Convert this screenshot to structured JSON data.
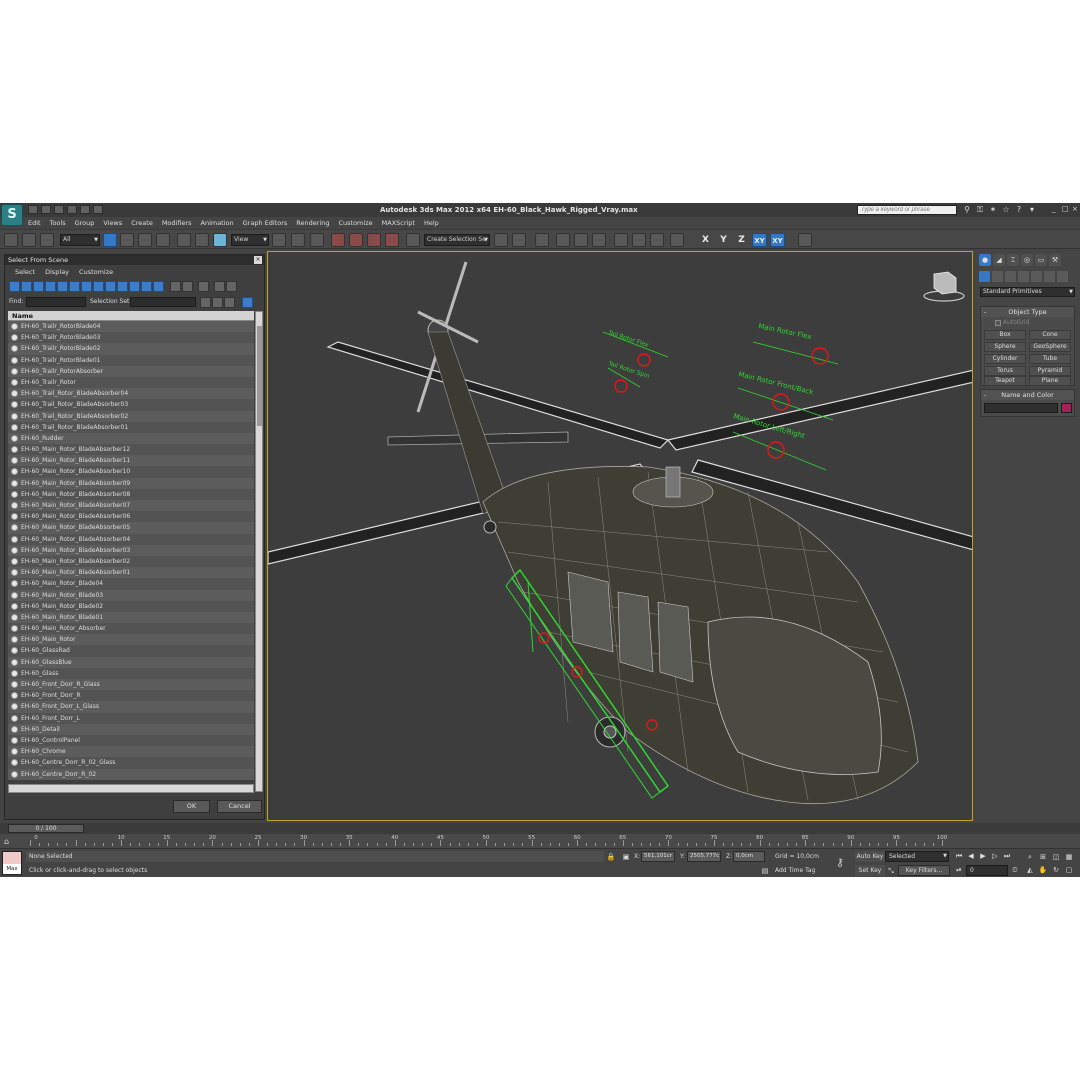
{
  "window": {
    "app_logo_glyph": "S",
    "title": "Autodesk 3ds Max  2012 x64      EH-60_Black_Hawk_Rigged_Vray.max",
    "search_placeholder": "Type a keyword or phrase",
    "controls": [
      "_",
      "□",
      "×"
    ]
  },
  "menu": [
    "Edit",
    "Tools",
    "Group",
    "Views",
    "Create",
    "Modifiers",
    "Animation",
    "Graph Editors",
    "Rendering",
    "Customize",
    "MAXScript",
    "Help"
  ],
  "toolbar": {
    "selection_filter": "All",
    "reference_coord": "View",
    "named_selection_set": "Create Selection Se",
    "axis_labels": [
      "X",
      "Y",
      "Z",
      "XY",
      "XY"
    ]
  },
  "select_dialog": {
    "title": "Select From Scene",
    "menu": [
      "Select",
      "Display",
      "Customize"
    ],
    "find_label": "Find:",
    "selection_set_label": "Selection Set:",
    "column_header": "Name",
    "items": [
      "EH-60_Trailr_RotorBlade04",
      "EH-60_Trailr_RotorBlade03",
      "EH-60_Trailr_RotorBlade02",
      "EH-60_Trailr_RotorBlade01",
      "EH-60_Trailr_RotorAbsorber",
      "EH-60_Trailr_Rotor",
      "EH-60_Trail_Rotor_BladeAbsorber04",
      "EH-60_Trail_Rotor_BladeAbsorber03",
      "EH-60_Trail_Rotor_BladeAbsorber02",
      "EH-60_Trail_Rotor_BladeAbsorber01",
      "EH-60_Rudder",
      "EH-60_Main_Rotor_BladeAbsorber12",
      "EH-60_Main_Rotor_BladeAbsorber11",
      "EH-60_Main_Rotor_BladeAbsorber10",
      "EH-60_Main_Rotor_BladeAbsorber09",
      "EH-60_Main_Rotor_BladeAbsorber08",
      "EH-60_Main_Rotor_BladeAbsorber07",
      "EH-60_Main_Rotor_BladeAbsorber06",
      "EH-60_Main_Rotor_BladeAbsorber05",
      "EH-60_Main_Rotor_BladeAbsorber04",
      "EH-60_Main_Rotor_BladeAbsorber03",
      "EH-60_Main_Rotor_BladeAbsorber02",
      "EH-60_Main_Rotor_BladeAbsorber01",
      "EH-60_Main_Rotor_Blade04",
      "EH-60_Main_Rotor_Blade03",
      "EH-60_Main_Rotor_Blade02",
      "EH-60_Main_Rotor_Blade01",
      "EH-60_Main_Rotor_Absorber",
      "EH-60_Main_Rotor",
      "EH-60_GlassRad",
      "EH-60_GlassBlue",
      "EH-60_Glass",
      "EH-60_Front_Dorr_R_Glass",
      "EH-60_Front_Dorr_R",
      "EH-60_Front_Dorr_L_Glass",
      "EH-60_Front_Dorr_L",
      "EH-60_Detail",
      "EH-60_ControlPanel",
      "EH-60_Chrome",
      "EH-60_Centre_Dorr_R_02_Glass",
      "EH-60_Centre_Dorr_R_02"
    ],
    "ok_label": "OK",
    "cancel_label": "Cancel"
  },
  "command_panel": {
    "category_dropdown": "Standard Primitives",
    "object_type_title": "Object Type",
    "autogrid_label": "AutoGrid",
    "primitives": [
      "Box",
      "Cone",
      "Sphere",
      "GeoSphere",
      "Cylinder",
      "Tube",
      "Torus",
      "Pyramid",
      "Teapot",
      "Plane"
    ],
    "name_color_title": "Name and Color",
    "object_color": "#a8205a"
  },
  "timeline": {
    "frame_display": "0 / 100",
    "ticks": [
      "0",
      "10",
      "15",
      "20",
      "25",
      "30",
      "35",
      "40",
      "45",
      "50",
      "55",
      "60",
      "65",
      "70",
      "75",
      "80",
      "85",
      "90",
      "95",
      "100"
    ]
  },
  "status": {
    "maxscript_label": "Max",
    "selection": "None Selected",
    "prompt": "Click or click-and-drag to select objects",
    "x_label": "X:",
    "x_value": "561,101cr",
    "y_label": "Y:",
    "y_value": "2505,777c",
    "z_label": "Z:",
    "z_value": "0,0cm",
    "grid": "Grid = 10,0cm",
    "add_time_tag": "Add Time Tag",
    "auto_key": "Auto Key",
    "set_key": "Set Key",
    "selected_dropdown": "Selected",
    "key_filters": "Key Filters...",
    "current_frame": "0"
  },
  "viewport": {
    "rig_labels": [
      "Tail Rotor Flex",
      "Tail Rotor Spin",
      "Main Rotor Flex",
      "Main Rotor Front/Back",
      "Main Rotor Left/Right"
    ],
    "rig_color": "#2fd62f",
    "handle_color": "#e01818",
    "active_border": "#c8a227"
  }
}
